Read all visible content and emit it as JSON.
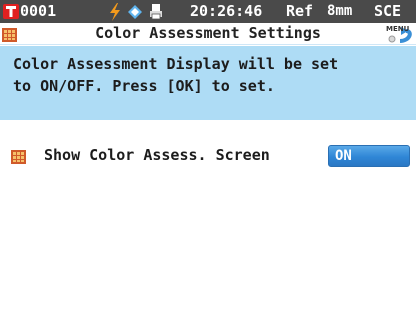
{
  "status_bar": {
    "target_no": "0001",
    "time": "20:26:46",
    "ref": "Ref",
    "aperture": "8mm",
    "mode": "SCE",
    "icons": [
      "t-code-icon",
      "power-icon",
      "pc-connection-icon",
      "printer-icon"
    ]
  },
  "title_bar": {
    "title": "Color Assessment Settings",
    "menu_label": "MENU"
  },
  "info": {
    "message": "Color Assessment Display will be set\nto ON/OFF. Press [OK] to set."
  },
  "setting": {
    "label": "Show Color Assess. Screen",
    "value": "ON"
  },
  "colors": {
    "status_bar_bg": "#4a4a4a",
    "info_panel_bg": "#aedcf5",
    "value_button": "#2f86d6",
    "t_code": "#e02020"
  }
}
